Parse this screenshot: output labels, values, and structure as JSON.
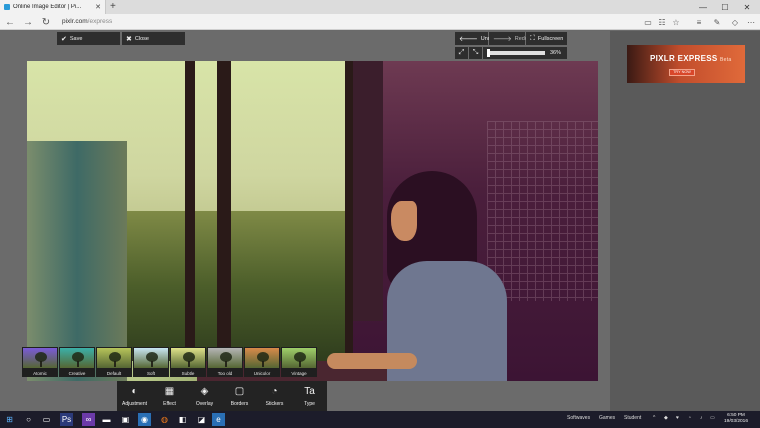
{
  "browser": {
    "tab_title": "Online Image Editor | Pi...",
    "new_tab": "+",
    "url_host": "pixlr.com",
    "url_path": "/express",
    "controls": {
      "minimize": "—",
      "maximize": "☐",
      "close": "✕"
    }
  },
  "editor": {
    "save_label": "Save",
    "close_label": "Close",
    "undo_label": "Undo",
    "redo_label": "Redo",
    "fullscreen_label": "Fullscreen",
    "zoom": {
      "value": 0.36,
      "label": "36%"
    }
  },
  "effects": [
    {
      "label": "Atomic",
      "tint": "#7a5ad8"
    },
    {
      "label": "Creative",
      "tint": "#3bb0a8"
    },
    {
      "label": "Default",
      "tint": "#b7c45a"
    },
    {
      "label": "Soft",
      "tint": "#c8e6f2"
    },
    {
      "label": "Subtle",
      "tint": "#dfe28a"
    },
    {
      "label": "Too old",
      "tint": "#b5b5b5"
    },
    {
      "label": "Unicolor",
      "tint": "#d88a4a"
    },
    {
      "label": "Vintage",
      "tint": "#9fd06a"
    }
  ],
  "tools": [
    {
      "label": "Adjustment",
      "icon": "◐",
      "name": "adjustment"
    },
    {
      "label": "Effect",
      "icon": "▦",
      "name": "effect"
    },
    {
      "label": "Overlay",
      "icon": "◈",
      "name": "overlay"
    },
    {
      "label": "Borders",
      "icon": "▢",
      "name": "borders"
    },
    {
      "label": "Stickers",
      "icon": "◔",
      "name": "stickers"
    },
    {
      "label": "Type",
      "icon": "Ta",
      "name": "type"
    }
  ],
  "ad": {
    "logo": "PIXLR EXPRESS",
    "beta": "Beta",
    "cta": "TRY NOW"
  },
  "taskbar": {
    "items": [
      "Softwaves",
      "Games",
      "Student"
    ],
    "time": "6:50 PM",
    "date": "19/03/2016"
  },
  "colors": {
    "toolbar_bg": "#2e2e2e",
    "editor_bg": "#6b6b6b",
    "sidebar_bg": "#5a5a5a",
    "accent_ad": "#e06a3a"
  }
}
